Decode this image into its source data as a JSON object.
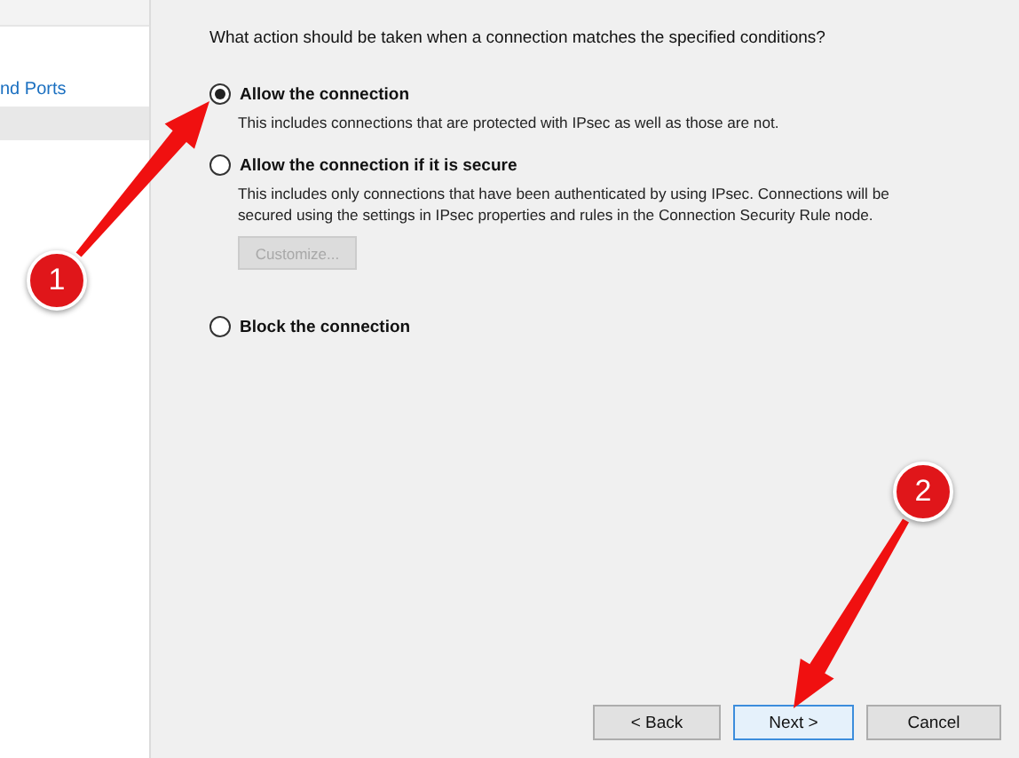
{
  "sidebar": {
    "items": [
      {
        "label": "nd Ports",
        "selected": false
      },
      {
        "selected": true
      }
    ]
  },
  "question": "What action should be taken when a connection matches the specified conditions?",
  "options": [
    {
      "title": "Allow the connection",
      "description": "This includes connections that are protected with IPsec as well as those are not.",
      "selected": true
    },
    {
      "title": "Allow the connection if it is secure",
      "description": "This includes only connections that have been authenticated by using IPsec.  Connections will be secured using the settings in IPsec properties and rules in the Connection Security Rule node.",
      "selected": false,
      "button": {
        "label": "Customize...",
        "disabled": true
      }
    },
    {
      "title": "Block the connection",
      "selected": false
    }
  ],
  "buttons": [
    {
      "label": "< Back",
      "focused": false
    },
    {
      "label": "Next >",
      "focused": true
    },
    {
      "label": "Cancel",
      "focused": false
    }
  ],
  "callouts": [
    {
      "number": "1"
    },
    {
      "number": "2"
    }
  ]
}
